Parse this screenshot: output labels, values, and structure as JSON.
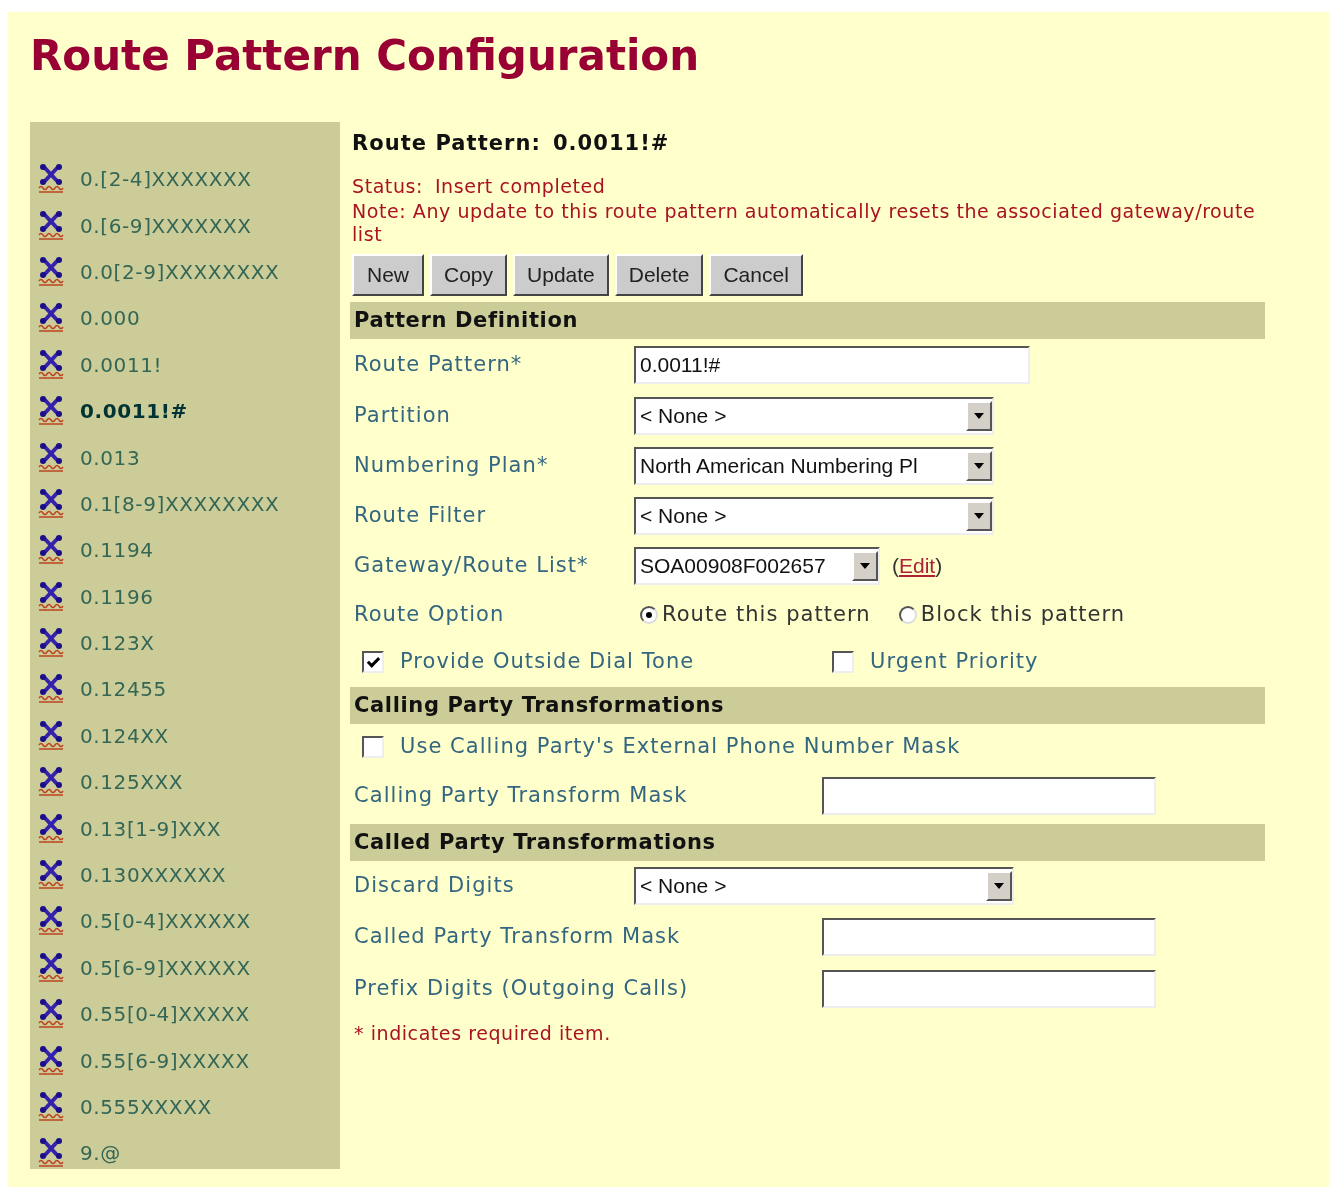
{
  "title": "Route Pattern Configuration",
  "sidebar": {
    "items": [
      {
        "label": "0.[2-4]XXXXXXX",
        "selected": false
      },
      {
        "label": "0.[6-9]XXXXXXX",
        "selected": false
      },
      {
        "label": "0.0[2-9]XXXXXXXX",
        "selected": false
      },
      {
        "label": "0.000",
        "selected": false
      },
      {
        "label": "0.0011!",
        "selected": false
      },
      {
        "label": "0.0011!#",
        "selected": true
      },
      {
        "label": "0.013",
        "selected": false
      },
      {
        "label": "0.1[8-9]XXXXXXXX",
        "selected": false
      },
      {
        "label": "0.1194",
        "selected": false
      },
      {
        "label": "0.1196",
        "selected": false
      },
      {
        "label": "0.123X",
        "selected": false
      },
      {
        "label": "0.12455",
        "selected": false
      },
      {
        "label": "0.124XX",
        "selected": false
      },
      {
        "label": "0.125XXX",
        "selected": false
      },
      {
        "label": "0.13[1-9]XXX",
        "selected": false
      },
      {
        "label": "0.130XXXXXX",
        "selected": false
      },
      {
        "label": "0.5[0-4]XXXXXX",
        "selected": false
      },
      {
        "label": "0.5[6-9]XXXXXX",
        "selected": false
      },
      {
        "label": "0.55[0-4]XXXXX",
        "selected": false
      },
      {
        "label": "0.55[6-9]XXXXX",
        "selected": false
      },
      {
        "label": "0.555XXXXX",
        "selected": false
      },
      {
        "label": "9.@",
        "selected": false
      }
    ]
  },
  "header": {
    "label": "Route Pattern:",
    "value": "0.0011!#"
  },
  "status": {
    "label": "Status:",
    "value": "Insert completed"
  },
  "note": "Note: Any update to this route pattern automatically resets the associated gateway/route list",
  "buttons": [
    "New",
    "Copy",
    "Update",
    "Delete",
    "Cancel"
  ],
  "sections": [
    {
      "title": "Pattern Definition",
      "rows": [
        {
          "kind": "text",
          "label": "Route Pattern*",
          "value": "0.0011!#"
        },
        {
          "kind": "select",
          "label": "Partition",
          "value": "< None >"
        },
        {
          "kind": "select",
          "label": "Numbering Plan*",
          "value": "North American Numbering Pl"
        },
        {
          "kind": "select",
          "label": "Route Filter",
          "value": "< None >"
        },
        {
          "kind": "select",
          "label": "Gateway/Route List*",
          "value": "SOA00908F002657",
          "link": {
            "before": "(",
            "label": "Edit",
            "after": ")"
          }
        },
        {
          "kind": "radio",
          "label": "Route Option",
          "options": [
            {
              "label": "Route this pattern",
              "selected": true
            },
            {
              "label": "Block this pattern",
              "selected": false
            }
          ]
        },
        {
          "kind": "checks",
          "options": [
            {
              "label": "Provide Outside Dial Tone",
              "checked": true
            },
            {
              "label": "Urgent Priority",
              "checked": false
            }
          ]
        }
      ]
    },
    {
      "title": "Calling Party Transformations",
      "rows": [
        {
          "kind": "checks",
          "options": [
            {
              "label": "Use Calling Party's External Phone Number Mask",
              "checked": false
            }
          ]
        },
        {
          "kind": "text",
          "label": "Calling Party Transform Mask"
        }
      ]
    },
    {
      "title": "Called Party Transformations",
      "rows": [
        {
          "kind": "select",
          "label": "Discard Digits",
          "value": "< None >"
        },
        {
          "kind": "text",
          "label": "Called Party Transform Mask"
        },
        {
          "kind": "text",
          "label": "Prefix Digits (Outgoing Calls)"
        }
      ]
    }
  ],
  "footnote": "* indicates required item."
}
